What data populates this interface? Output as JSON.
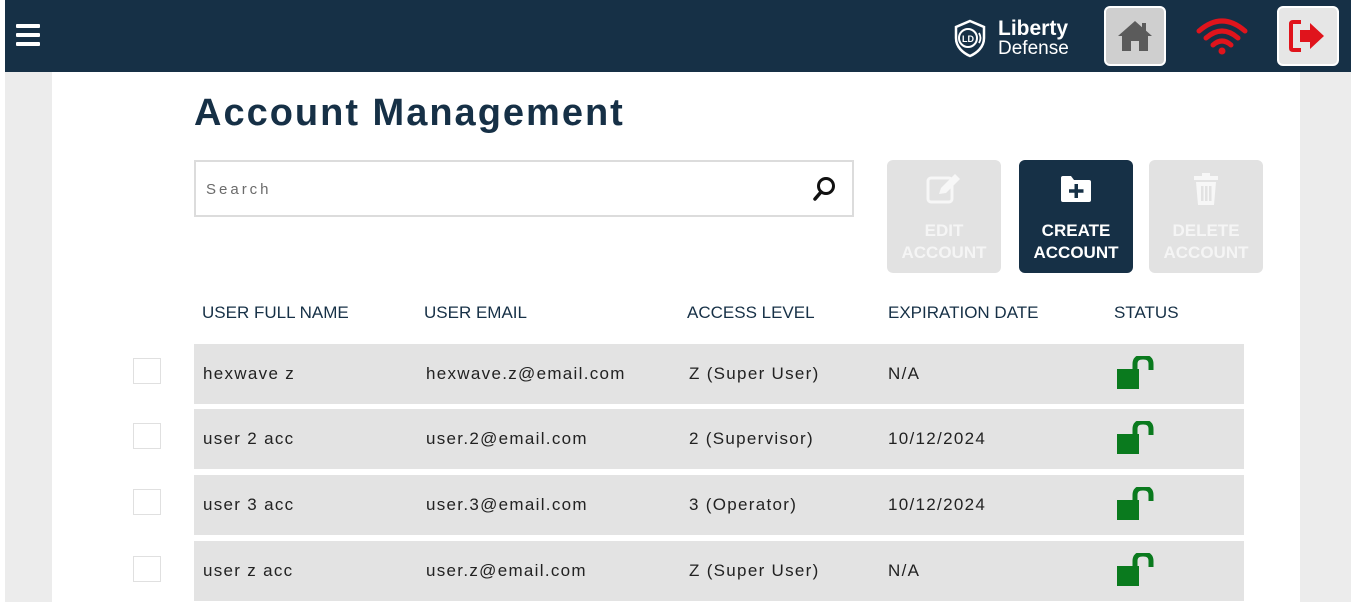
{
  "header": {
    "brand": {
      "line1": "Liberty",
      "line2": "Defense",
      "logo_initials": "LD"
    },
    "icons": [
      "menu-icon",
      "home-icon",
      "wifi-icon",
      "logout-icon"
    ],
    "colors": {
      "bar": "#163046",
      "wifi": "#e0141c",
      "logout": "#e0141c"
    }
  },
  "page": {
    "title": "Account Management",
    "search": {
      "placeholder": "Search",
      "value": ""
    }
  },
  "actions": {
    "edit": {
      "line1": "EDIT",
      "line2": "ACCOUNT",
      "enabled": false,
      "icon": "edit-icon"
    },
    "create": {
      "line1": "CREATE",
      "line2": "ACCOUNT",
      "enabled": true,
      "icon": "folder-plus-icon"
    },
    "delete": {
      "line1": "DELETE",
      "line2": "ACCOUNT",
      "enabled": false,
      "icon": "trash-icon"
    }
  },
  "table": {
    "columns": [
      "USER FULL NAME",
      "USER EMAIL",
      "ACCESS LEVEL",
      "EXPIRATION DATE",
      "STATUS"
    ],
    "rows": [
      {
        "name": "hexwave z",
        "email": "hexwave.z@email.com",
        "access": "Z (Super User)",
        "expiration": "N/A",
        "status": "unlocked"
      },
      {
        "name": "user 2 acc",
        "email": "user.2@email.com",
        "access": "2 (Supervisor)",
        "expiration": "10/12/2024",
        "status": "unlocked"
      },
      {
        "name": "user 3 acc",
        "email": "user.3@email.com",
        "access": "3 (Operator)",
        "expiration": "10/12/2024",
        "status": "unlocked"
      },
      {
        "name": "user z acc",
        "email": "user.z@email.com",
        "access": "Z (Super User)",
        "expiration": "N/A",
        "status": "unlocked"
      }
    ],
    "status_color": "#0a7a1e"
  }
}
